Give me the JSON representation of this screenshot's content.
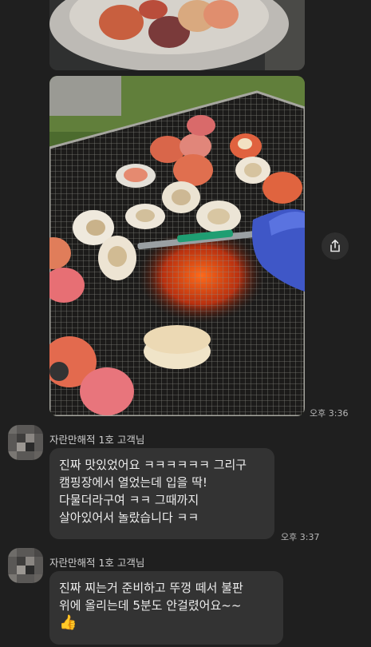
{
  "messages": [
    {
      "sender": "자란만해적 1호 고객님",
      "lines": [
        "진짜 맛있었어요 ㅋㅋㅋㅋㅋㅋ 그리구",
        "캠핑장에서 열었는데 입을 딱!",
        "다물더라구여 ㅋㅋ 그때까지",
        "살아있어서 놀랐습니다 ㅋㅋ"
      ],
      "time": "오후 3:37"
    },
    {
      "sender": "자란만해적 1호 고객님",
      "lines": [
        "진짜 찌는거 준비하고 뚜껑 떼서 불판",
        "위에 올리는데 5분도 안걸렸어요~~",
        "👍"
      ]
    }
  ],
  "photo_message": {
    "time": "오후 3:36"
  },
  "icons": {
    "share": "share-icon"
  },
  "colors": {
    "background": "#1f1f1f",
    "bubble": "#333333"
  }
}
